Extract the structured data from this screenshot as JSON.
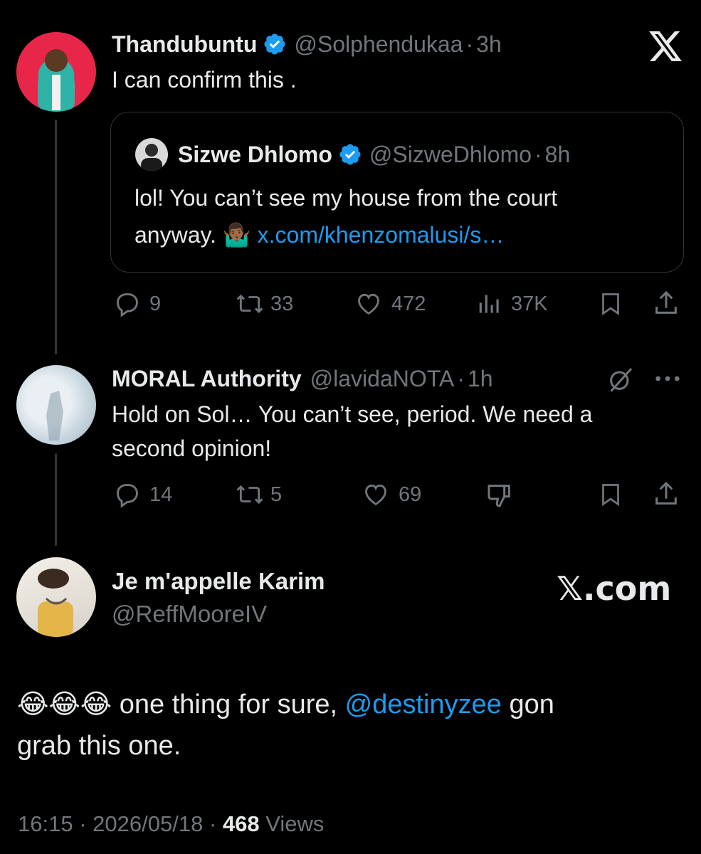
{
  "tweet1": {
    "name": "Thandubuntu",
    "handle": "@Solphendukaa",
    "sep": "·",
    "time": "3h",
    "text": "I can confirm this ."
  },
  "quote": {
    "name": "Sizwe Dhlomo",
    "handle": "@SizweDhlomo",
    "sep": "·",
    "time": "8h",
    "line1": "lol! You can’t see my house from the court",
    "line2_prefix": "anyway. 🤷🏾‍♂️ ",
    "link": "x.com/khenzomalusi/s…"
  },
  "tweet1_actions": {
    "replies": "9",
    "retweets": "33",
    "likes": "472",
    "views": "37K"
  },
  "tweet2": {
    "name": "MORAL Authority",
    "handle": "@lavidaNOTA",
    "sep": "·",
    "time": "1h",
    "line1": "Hold on Sol… You can’t see, period. We need a",
    "line2": "second opinion!"
  },
  "tweet2_actions": {
    "replies": "14",
    "retweets": "5",
    "likes": "69"
  },
  "main": {
    "name": "Je m'appelle Karim",
    "handle": "@ReffMooreIV",
    "brand": "𝕏.com",
    "emojis": "😂😂😂",
    "text_pre": " one thing for sure, ",
    "mention": "@destinyzee",
    "text_post": " gon",
    "line2": "grab this one.",
    "time": "16:15",
    "date": "2026/05/18",
    "sep": "·",
    "views_count": "468",
    "views_label": "Views"
  },
  "colors": {
    "background": "#000000",
    "text": "#e7e9ea",
    "muted": "#71767b",
    "link": "#1d9bf0",
    "verified": "#1d9bf0"
  }
}
